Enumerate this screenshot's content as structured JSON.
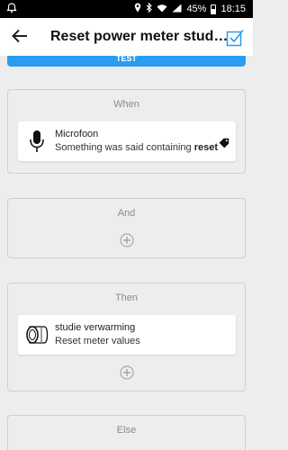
{
  "status_bar": {
    "battery": "45%",
    "time": "18:15"
  },
  "header": {
    "title": "Reset power meter studie verwarming"
  },
  "test_bar": {
    "label": "TEST"
  },
  "sections": {
    "when": {
      "label": "When",
      "card": {
        "icon": "microphone-icon",
        "title": "Microfoon",
        "subtitle_prefix": "Something was said containing",
        "subtitle_keyword": "reset"
      }
    },
    "and": {
      "label": "And"
    },
    "then": {
      "label": "Then",
      "card": {
        "icon": "power-meter-icon",
        "title": "studie verwarming",
        "subtitle": "Reset meter values"
      }
    },
    "else": {
      "label": "Else"
    }
  },
  "colors": {
    "accent": "#2a9cf2",
    "background": "#ededed"
  }
}
